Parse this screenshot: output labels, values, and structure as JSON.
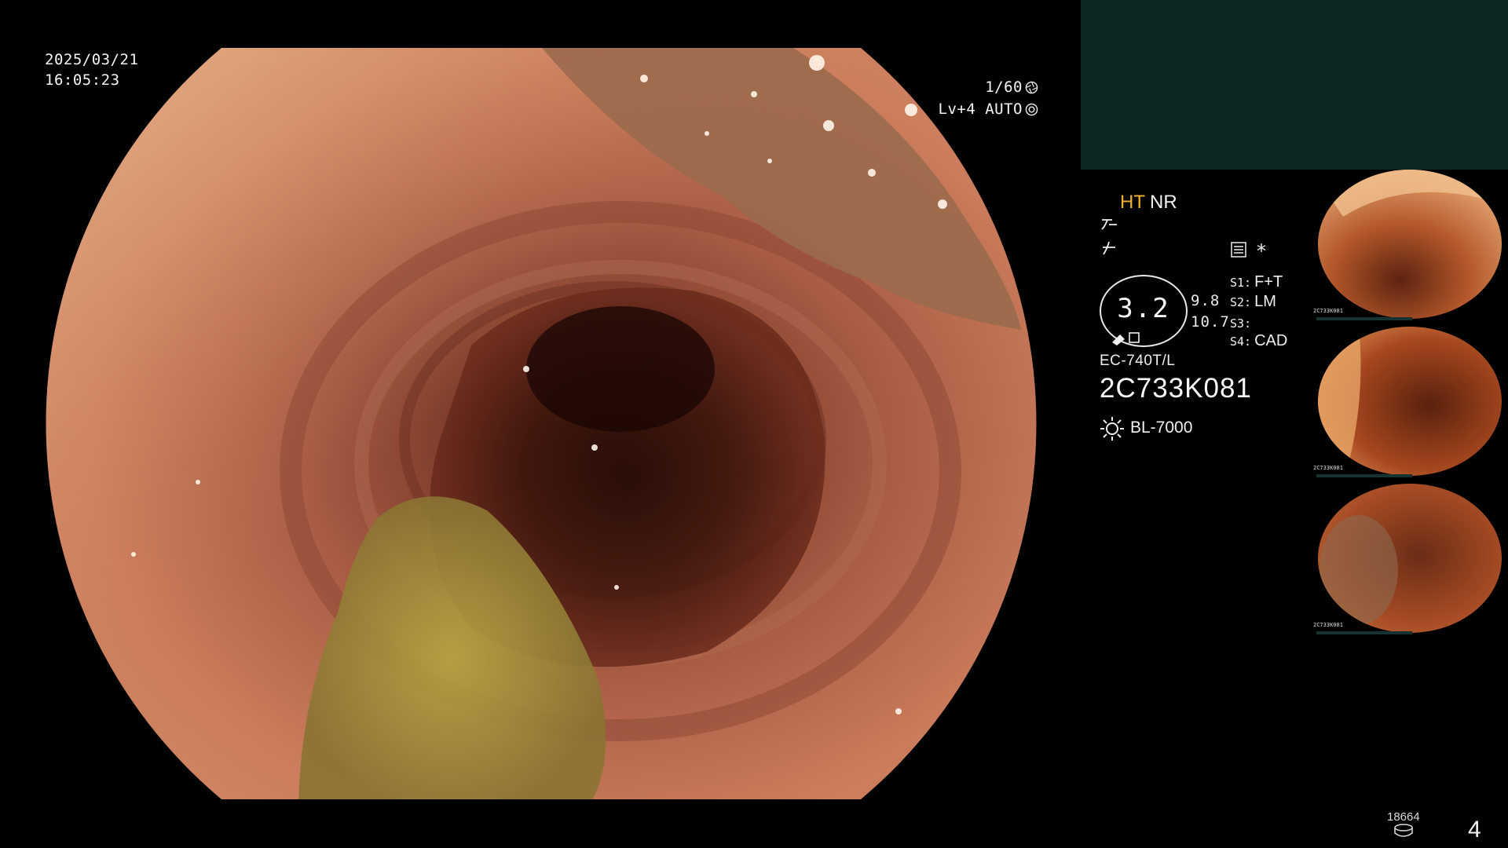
{
  "overlay": {
    "date": "2025/03/21",
    "time": "16:05:23",
    "shutter": "1/60",
    "level": "Lv+4 AUTO"
  },
  "panel": {
    "mode_ht": "HT",
    "mode_nr": "NR",
    "circle_value": "3.2",
    "side_values": [
      "9.8",
      "10.7"
    ],
    "settings": [
      {
        "key": "S1:",
        "value": "F+T"
      },
      {
        "key": "S2:",
        "value": "LM"
      },
      {
        "key": "S3:",
        "value": ""
      },
      {
        "key": "S4:",
        "value": "CAD"
      }
    ],
    "asterisk": "*",
    "model": "EC-740T/L",
    "serial": "2C733K081",
    "light_source": "BL-7000"
  },
  "thumbnails": [
    {
      "id": "2C733K081"
    },
    {
      "id": "2C733K081"
    },
    {
      "id": "2C733K081"
    }
  ],
  "footer": {
    "counter": "18664",
    "page_number": "4"
  },
  "colors": {
    "accent_ht": "#f2b32a",
    "panel_teal": "#0c2624"
  },
  "icons": {
    "shutter": "aperture-icon",
    "auto_level": "target-icon",
    "settings": "settings-list-icon",
    "light": "sun-icon",
    "storage": "database-icon"
  }
}
